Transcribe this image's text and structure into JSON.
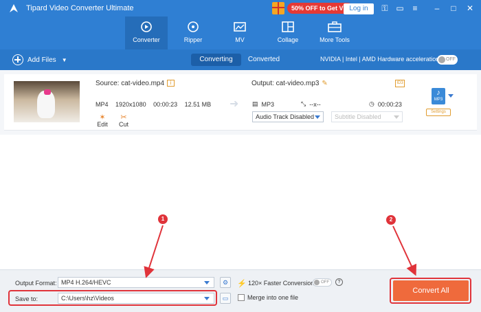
{
  "app": {
    "title": "Tipard Video Converter Ultimate"
  },
  "titlebar": {
    "promo_text": "50% OFF to Get VIP",
    "login_label": "Log in"
  },
  "nav": {
    "tabs": [
      {
        "label": "Converter",
        "icon": "converter-icon",
        "active": true
      },
      {
        "label": "Ripper",
        "icon": "disc-icon",
        "active": false
      },
      {
        "label": "MV",
        "icon": "mv-icon",
        "active": false
      },
      {
        "label": "Collage",
        "icon": "collage-icon",
        "active": false
      },
      {
        "label": "More Tools",
        "icon": "toolbox-icon",
        "active": false
      }
    ]
  },
  "toolbar": {
    "add_files_label": "Add Files",
    "tab_converting": "Converting",
    "tab_converted": "Converted",
    "hw_label": "NVIDIA | Intel | AMD Hardware acceleration",
    "hw_toggle": "OFF"
  },
  "file": {
    "source_label": "Source: cat-video.mp4",
    "format": "MP4",
    "resolution": "1920x1080",
    "duration": "00:00:23",
    "size": "12.51 MB",
    "edit_label": "Edit",
    "cut_label": "Cut",
    "output_label": "Output: cat-video.mp3",
    "id3_label": "ID3",
    "out_format": "MP3",
    "out_resolution": "--x--",
    "out_duration": "00:00:23",
    "audio_track": "Audio Track Disabled",
    "subtitle": "Subtitle Disabled",
    "format_badge": "MP3",
    "settings_label": "Settings"
  },
  "bottom": {
    "output_format_label": "Output Format:",
    "output_format_value": "MP4 H.264/HEVC",
    "save_to_label": "Save to:",
    "save_to_value": "C:\\Users\\hz\\Videos",
    "faster_label": "120× Faster Conversion",
    "faster_toggle": "OFF",
    "merge_label": "Merge into one file",
    "convert_all_label": "Convert All"
  },
  "annotations": {
    "marker_1": "1",
    "marker_2": "2"
  },
  "colors": {
    "brand": "#2f7fd3",
    "accent": "#ef6a3c",
    "highlight": "#e0333a"
  }
}
